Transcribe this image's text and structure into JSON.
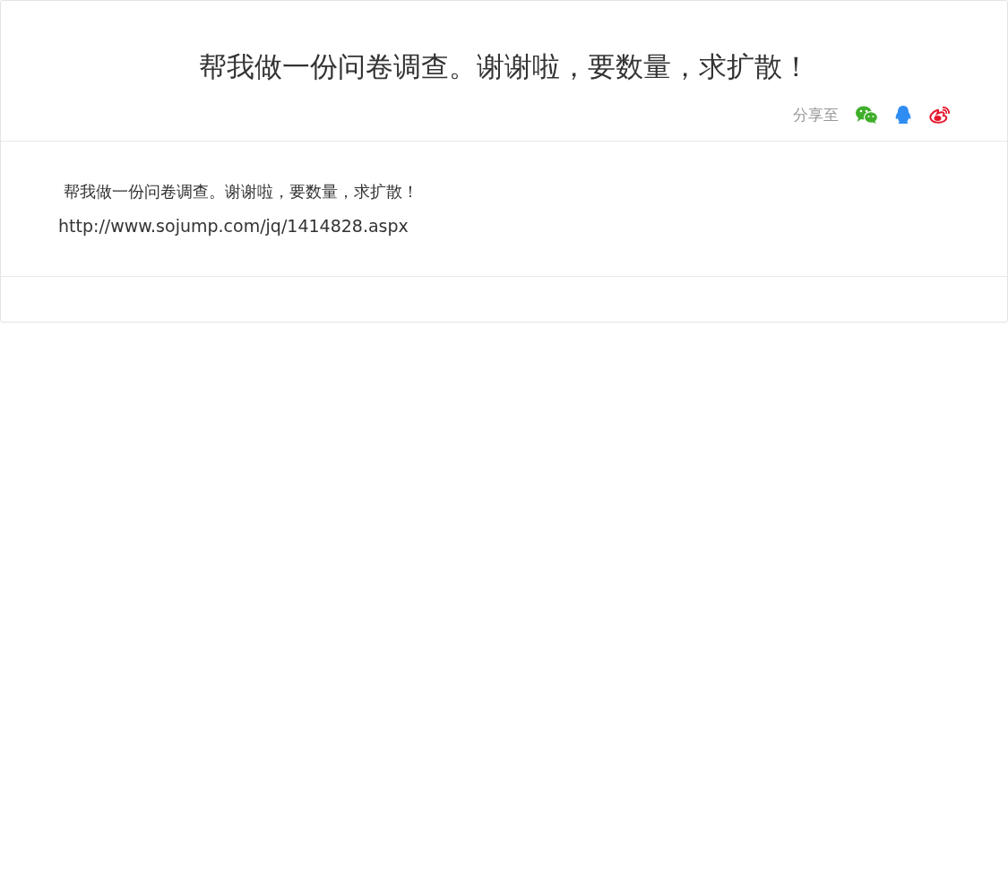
{
  "post": {
    "title": "帮我做一份问卷调查。谢谢啦，要数量，求扩散！",
    "share": {
      "label": "分享至",
      "targets": [
        {
          "kind": "chat"
        },
        {
          "kind": "penguin"
        },
        {
          "kind": "eye"
        }
      ]
    },
    "body": {
      "text": "帮我做一份问卷调查。谢谢啦，要数量，求扩散！",
      "link": "http://www.sojump.com/jq/1414828.aspx"
    }
  }
}
